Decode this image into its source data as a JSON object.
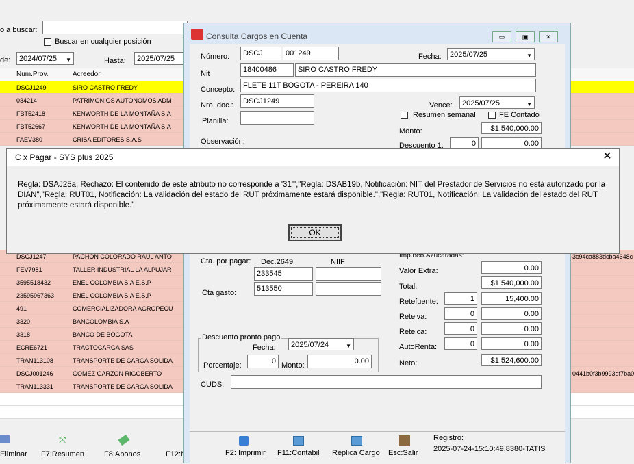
{
  "bg": {
    "search_label": "o a buscar:",
    "any_position_label": "Buscar en cualquier posición",
    "from_label": "de:",
    "from_date": "2024/07/25",
    "to_label": "Hasta:",
    "to_date": "2025/07/25",
    "col_numprov": "Num.Prov.",
    "col_acreedor": "Acreedor",
    "rows": [
      {
        "num": "DSCJ1249",
        "acreedor": "SIRO CASTRO FREDY",
        "extra": ""
      },
      {
        "num": "034214",
        "acreedor": "PATRIMONIOS AUTONOMOS ADM",
        "extra": ""
      },
      {
        "num": "FBT52418",
        "acreedor": "KENWORTH DE LA MONTAÑA  S.A",
        "extra": ""
      },
      {
        "num": "FBT52667",
        "acreedor": "KENWORTH DE LA MONTAÑA  S.A",
        "extra": ""
      },
      {
        "num": "FAEV380",
        "acreedor": "CRISA EDITORES S.A.S",
        "extra": ""
      },
      {
        "num": "DSCJ1247",
        "acreedor": "PACHON COLORADO RAUL ANTO",
        "extra": "3c94ca883dcba4648c"
      },
      {
        "num": "FEV7981",
        "acreedor": "TALLER INDUSTRIAL LA ALPUJAR",
        "extra": ""
      },
      {
        "num": "3595518432",
        "acreedor": "ENEL COLOMBIA S.A E.S.P",
        "extra": ""
      },
      {
        "num": "23595967363",
        "acreedor": "ENEL COLOMBIA S.A E.S.P",
        "extra": ""
      },
      {
        "num": "491",
        "acreedor": "COMERCIALIZADORA AGROPECU",
        "extra": ""
      },
      {
        "num": "3320",
        "acreedor": "BANCOLOMBIA S.A",
        "extra": ""
      },
      {
        "num": "3318",
        "acreedor": "BANCO DE BOGOTA",
        "extra": ""
      },
      {
        "num": "ECRE6721",
        "acreedor": "TRACTOCARGA SAS",
        "extra": ""
      },
      {
        "num": "TRAN113108",
        "acreedor": "TRANSPORTE DE CARGA SOLIDA",
        "extra": ""
      },
      {
        "num": "DSCJ001246",
        "acreedor": "GOMEZ GARZON RIGOBERTO",
        "extra": "0441b0f3b9993df7ba0"
      },
      {
        "num": "TRAN113331",
        "acreedor": "TRANSPORTE DE CARGA SOLIDA",
        "extra": ""
      }
    ],
    "bottom_buttons": [
      "Eliminar",
      "F7:Resumen",
      "F8:Abonos",
      "F12:N"
    ]
  },
  "win": {
    "title": "Consulta Cargos en Cuenta",
    "numero_label": "Número:",
    "numero_prefix": "DSCJ",
    "numero_value": "001249",
    "fecha_label": "Fecha:",
    "fecha": "2025/07/25",
    "nit_label": "Nit",
    "nit": "18400486",
    "nit_name": "SIRO CASTRO FREDY",
    "concepto_label": "Concepto:",
    "concepto": "FLETE 11T BOGOTA - PEREIRA 140",
    "nrodoc_label": "Nro. doc.:",
    "nrodoc": "DSCJ1249",
    "vence_label": "Vence:",
    "vence": "2025/07/25",
    "resumen_semanal_label": "Resumen semanal",
    "fe_contado_label": "FE Contado",
    "planilla_label": "Planilla:",
    "monto_label": "Monto:",
    "monto": "$1,540,000.00",
    "observacion_label": "Observación:",
    "descuento1_label": "Descuento 1:",
    "descuento1_pct": "0",
    "descuento1_val": "0.00",
    "imp_label": "Imp.beb.Azucaradas:",
    "cta_pagar_label": "Cta. por pagar:",
    "dec_label": "Dec.2649",
    "niif_label": "NIIF",
    "cta_pagar": "233545",
    "cta_gasto_label": "Cta gasto:",
    "cta_gasto": "513550",
    "valor_extra_label": "Valor Extra:",
    "valor_extra": "0.00",
    "total_label": "Total:",
    "total": "$1,540,000.00",
    "retefuente_label": "Retefuente:",
    "retefuente_pct": "1",
    "retefuente_val": "15,400.00",
    "reteiva_label": "Reteiva:",
    "reteiva_pct": "0",
    "reteiva_val": "0.00",
    "reteica_label": "Reteica:",
    "reteica_pct": "0",
    "reteica_val": "0.00",
    "autorenta_label": "AutoRenta:",
    "autorenta_pct": "0",
    "autorenta_val": "0.00",
    "neto_label": "Neto:",
    "neto": "$1,524,600.00",
    "dpp_title": "Descuento pronto pago",
    "dpp_fecha_label": "Fecha:",
    "dpp_fecha": "2025/07/24",
    "porcentaje_label": "Porcentaje:",
    "porcentaje": "0",
    "dpp_monto_label": "Monto:",
    "dpp_monto": "0.00",
    "cuds_label": "CUDS:",
    "btn_imprimir": "F2: Imprimir",
    "btn_contabil": "F11:Contabil",
    "btn_replica": "Replica Cargo",
    "btn_salir": "Esc:Salir",
    "registro_label": "Registro:",
    "registro": "2025-07-24-15:10:49.8380-TATIS"
  },
  "modal": {
    "title": "C x Pagar - SYS plus 2025",
    "message": "Regla: DSAJ25a, Rechazo: El contenido de este atributo no corresponde a '31'\",\"Regla: DSAB19b, Notificación: NIT del Prestador de Servicios no está autorizado por la DIAN\",\"Regla: RUT01, Notificación: La validación del estado del RUT próximamente estará disponible.\",\"Regla: RUT01, Notificación: La validación del estado del RUT próximamente estará disponible.\"",
    "ok": "OK"
  }
}
